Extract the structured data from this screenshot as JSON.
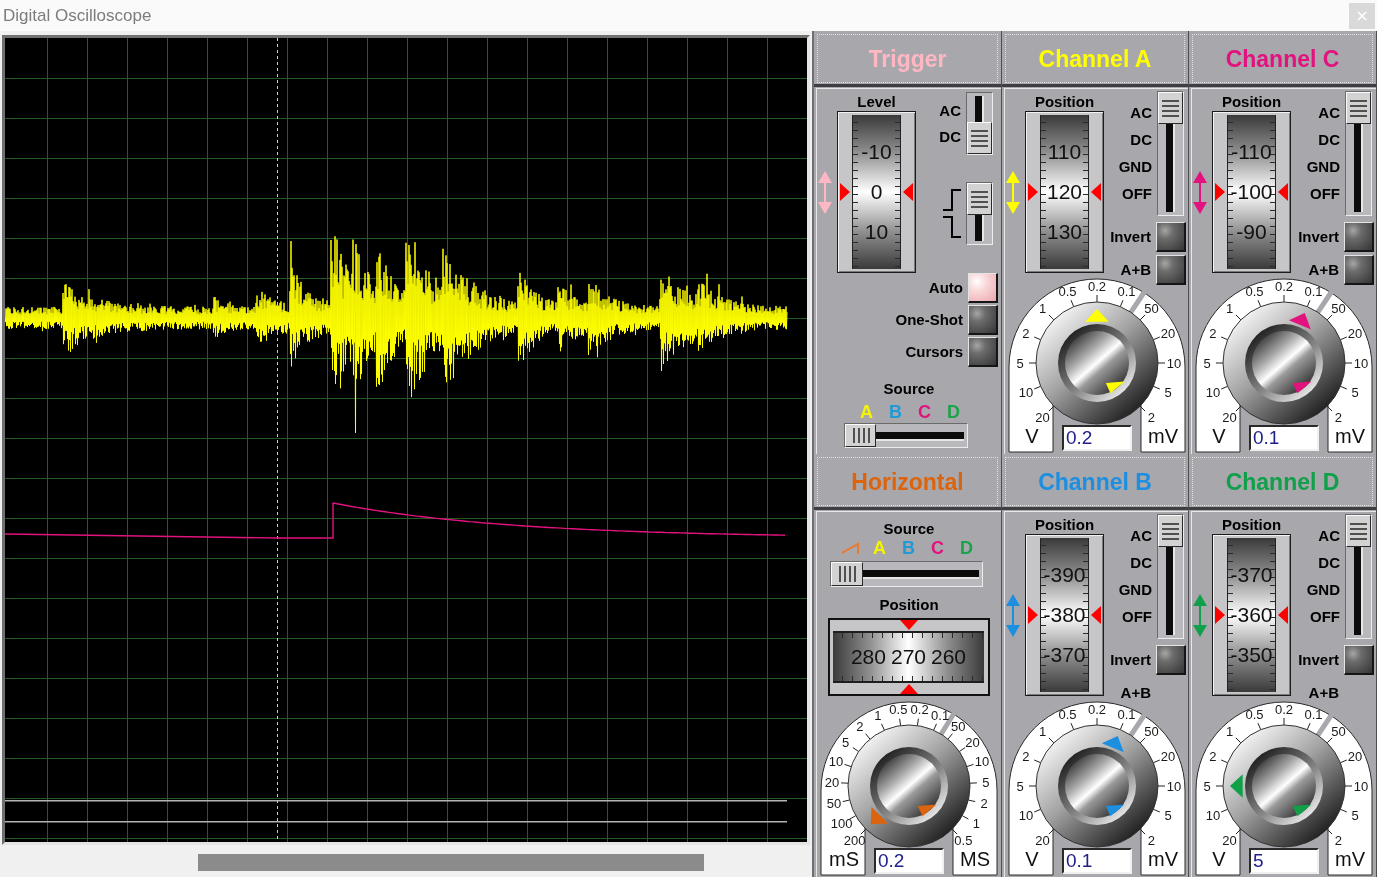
{
  "window": {
    "title": "Digital Oscilloscope"
  },
  "screen": {
    "traces": [
      {
        "kind": "noise",
        "color": "#ffff00"
      },
      {
        "kind": "step",
        "color": "#e2127e"
      },
      {
        "kind": "flat",
        "color": "#b4b4b4"
      },
      {
        "kind": "flat",
        "color": "#b4b4b4"
      }
    ]
  },
  "panels": [
    {
      "kind": "trigger",
      "title": "Trigger",
      "color": "#ffb8c3",
      "level": {
        "label": "Level",
        "scale": [
          "-10",
          "0",
          "10"
        ]
      },
      "coupling": [
        {
          "label": "AC",
          "selected": false
        },
        {
          "label": "DC",
          "selected": true
        }
      ],
      "edges": [
        {
          "kind": "rising",
          "selected": true
        },
        {
          "kind": "falling",
          "selected": false
        }
      ],
      "buttons": [
        {
          "label": "Auto",
          "on": true
        },
        {
          "label": "One-Shot",
          "on": false
        },
        {
          "label": "Cursors",
          "on": false
        }
      ],
      "source": {
        "label": "Source",
        "options": [
          {
            "label": "A",
            "color": "#f5f500",
            "selected": true
          },
          {
            "label": "B",
            "color": "#1e9bd7",
            "selected": false
          },
          {
            "label": "C",
            "color": "#e2127e",
            "selected": false
          },
          {
            "label": "D",
            "color": "#18a448",
            "selected": false
          }
        ]
      }
    },
    {
      "kind": "channel",
      "title": "Channel A",
      "color": "#ffff00",
      "position": {
        "label": "Position",
        "scale": [
          "110",
          "120",
          "130"
        ]
      },
      "coupling": [
        {
          "label": "AC",
          "selected": true
        },
        {
          "label": "DC",
          "selected": false
        },
        {
          "label": "GND",
          "selected": false
        },
        {
          "label": "OFF",
          "selected": false
        }
      ],
      "invert": {
        "label": "Invert",
        "on": false
      },
      "combine": {
        "kind": "toggle",
        "label": "A+B",
        "on": false
      },
      "dial": {
        "ranges": [
          {
            "unit": "V",
            "ticks": [
              {
                "label": "0.5",
                "selected": false
              },
              {
                "label": "0.2",
                "selected": true
              },
              {
                "label": "0.1",
                "selected": false
              },
              {
                "label": "1",
                "selected": false
              },
              {
                "label": "2",
                "selected": false
              },
              {
                "label": "5",
                "selected": false
              },
              {
                "label": "10",
                "selected": false
              },
              {
                "label": "20",
                "selected": false
              }
            ]
          },
          {
            "unit": "mV",
            "ticks": [
              {
                "label": "50",
                "selected": false
              },
              {
                "label": "20",
                "selected": false
              },
              {
                "label": "10",
                "selected": false
              },
              {
                "label": "5",
                "selected": false
              },
              {
                "label": "2",
                "selected": false
              }
            ]
          }
        ],
        "value": "0.2"
      }
    },
    {
      "kind": "channel",
      "title": "Channel C",
      "color": "#e2127e",
      "position": {
        "label": "Position",
        "scale": [
          "-110",
          "-100",
          "-90"
        ]
      },
      "coupling": [
        {
          "label": "AC",
          "selected": true
        },
        {
          "label": "DC",
          "selected": false
        },
        {
          "label": "GND",
          "selected": false
        },
        {
          "label": "OFF",
          "selected": false
        }
      ],
      "invert": {
        "label": "Invert",
        "on": false
      },
      "combine": {
        "kind": "toggle",
        "label": "A+B",
        "on": false
      },
      "dial": {
        "ranges": [
          {
            "unit": "V",
            "ticks": [
              {
                "label": "0.5",
                "selected": false
              },
              {
                "label": "0.2",
                "selected": false
              },
              {
                "label": "0.1",
                "selected": true
              },
              {
                "label": "1",
                "selected": false
              },
              {
                "label": "2",
                "selected": false
              },
              {
                "label": "5",
                "selected": false
              },
              {
                "label": "10",
                "selected": false
              },
              {
                "label": "20",
                "selected": false
              }
            ]
          },
          {
            "unit": "mV",
            "ticks": [
              {
                "label": "50",
                "selected": false
              },
              {
                "label": "20",
                "selected": false
              },
              {
                "label": "10",
                "selected": false
              },
              {
                "label": "5",
                "selected": false
              },
              {
                "label": "2",
                "selected": false
              }
            ]
          }
        ],
        "value": "0.1"
      }
    },
    {
      "kind": "horizontal",
      "title": "Horizontal",
      "color": "#dc640e",
      "source": {
        "label": "Source",
        "options": [
          {
            "kind": "ramp",
            "color": "#e87a30",
            "selected": true
          },
          {
            "kind": "letter",
            "label": "A",
            "color": "#f5f500",
            "selected": false
          },
          {
            "kind": "letter",
            "label": "B",
            "color": "#1e9bd7",
            "selected": false
          },
          {
            "kind": "letter",
            "label": "C",
            "color": "#e2127e",
            "selected": false
          },
          {
            "kind": "letter",
            "label": "D",
            "color": "#18a448",
            "selected": false
          }
        ]
      },
      "position": {
        "label": "Position",
        "scale": [
          "280",
          "270",
          "260"
        ]
      },
      "dial": {
        "ranges": [
          {
            "unit": "mS",
            "ticks": [
              {
                "label": "1",
                "selected": false
              },
              {
                "label": "0.5",
                "selected": false
              },
              {
                "label": "0.2",
                "selected": false
              },
              {
                "label": "0.1",
                "selected": false
              },
              {
                "label": "2",
                "selected": false
              },
              {
                "label": "5",
                "selected": false
              },
              {
                "label": "10",
                "selected": false
              },
              {
                "label": "20",
                "selected": false
              },
              {
                "label": "50",
                "selected": false
              },
              {
                "label": "100",
                "selected": false
              },
              {
                "label": "200",
                "selected": true
              }
            ]
          },
          {
            "unit": "MS",
            "ticks": [
              {
                "label": "50",
                "selected": false
              },
              {
                "label": "20",
                "selected": false
              },
              {
                "label": "10",
                "selected": false
              },
              {
                "label": "5",
                "selected": false
              },
              {
                "label": "2",
                "selected": false
              },
              {
                "label": "1",
                "selected": false
              },
              {
                "label": "0.5",
                "selected": false
              }
            ]
          }
        ],
        "value": "0.2"
      }
    },
    {
      "kind": "channel",
      "title": "Channel B",
      "color": "#1c8fe0",
      "position": {
        "label": "Position",
        "scale": [
          "-390",
          "-380",
          "-370"
        ]
      },
      "coupling": [
        {
          "label": "AC",
          "selected": true
        },
        {
          "label": "DC",
          "selected": false
        },
        {
          "label": "GND",
          "selected": false
        },
        {
          "label": "OFF",
          "selected": false
        }
      ],
      "invert": {
        "label": "Invert",
        "on": false
      },
      "combine": {
        "kind": "label",
        "label": "A+B"
      },
      "dial": {
        "ranges": [
          {
            "unit": "V",
            "ticks": [
              {
                "label": "0.5",
                "selected": false
              },
              {
                "label": "0.2",
                "selected": false
              },
              {
                "label": "0.1",
                "selected": true
              },
              {
                "label": "1",
                "selected": false
              },
              {
                "label": "2",
                "selected": false
              },
              {
                "label": "5",
                "selected": false
              },
              {
                "label": "10",
                "selected": false
              },
              {
                "label": "20",
                "selected": false
              }
            ]
          },
          {
            "unit": "mV",
            "ticks": [
              {
                "label": "50",
                "selected": false
              },
              {
                "label": "20",
                "selected": false
              },
              {
                "label": "10",
                "selected": false
              },
              {
                "label": "5",
                "selected": false
              },
              {
                "label": "2",
                "selected": false
              }
            ]
          }
        ],
        "value": "0.1"
      }
    },
    {
      "kind": "channel",
      "title": "Channel D",
      "color": "#10a04a",
      "position": {
        "label": "Position",
        "scale": [
          "-370",
          "-360",
          "-350"
        ]
      },
      "coupling": [
        {
          "label": "AC",
          "selected": true
        },
        {
          "label": "DC",
          "selected": false
        },
        {
          "label": "GND",
          "selected": false
        },
        {
          "label": "OFF",
          "selected": false
        }
      ],
      "invert": {
        "label": "Invert",
        "on": false
      },
      "combine": {
        "kind": "label",
        "label": "A+B"
      },
      "dial": {
        "ranges": [
          {
            "unit": "V",
            "ticks": [
              {
                "label": "0.5",
                "selected": false
              },
              {
                "label": "0.2",
                "selected": false
              },
              {
                "label": "0.1",
                "selected": false
              },
              {
                "label": "1",
                "selected": false
              },
              {
                "label": "2",
                "selected": false
              },
              {
                "label": "5",
                "selected": true
              },
              {
                "label": "10",
                "selected": false
              },
              {
                "label": "20",
                "selected": false
              }
            ]
          },
          {
            "unit": "mV",
            "ticks": [
              {
                "label": "50",
                "selected": false
              },
              {
                "label": "20",
                "selected": false
              },
              {
                "label": "10",
                "selected": false
              },
              {
                "label": "5",
                "selected": false
              },
              {
                "label": "2",
                "selected": false
              }
            ]
          }
        ],
        "value": "5"
      }
    }
  ]
}
